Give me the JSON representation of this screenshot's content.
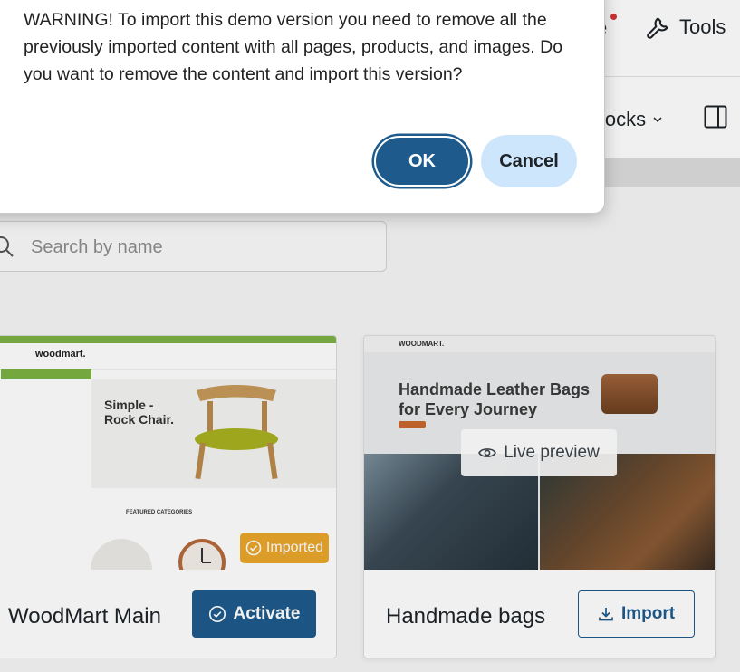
{
  "dialog": {
    "message": "WARNING! To import this demo version you need to remove all the previously imported content with all pages, products, and images. Do you want to remove the content and import this version?",
    "ok_label": "OK",
    "cancel_label": "Cancel"
  },
  "header": {
    "partial_text": "e",
    "tools_label": "Tools",
    "tools_icon": "wrench-icon",
    "notification_color": "#d63638"
  },
  "toolbar": {
    "blocks_partial_label": "locks",
    "panel_icon": "sidebar-panel-icon"
  },
  "search": {
    "placeholder": "Search by name"
  },
  "demos": [
    {
      "title": "WoodMart Main",
      "status_badge": "Imported",
      "action_label": "Activate",
      "thumbnail": {
        "logo": "woodmart.",
        "hero_line1": "Simple -",
        "hero_line2": "Rock Chair.",
        "section": "FEATURED CATEGORIES"
      }
    },
    {
      "title": "Handmade bags",
      "overlay_label": "Live preview",
      "action_label": "Import",
      "thumbnail": {
        "brand": "WOODMART.",
        "hero_line1": "Handmade Leather Bags",
        "hero_line2": "for Every Journey"
      }
    }
  ],
  "colors": {
    "primary": "#1e5b8c",
    "cancel_bg": "#cde6fb",
    "badge": "#e9a72a",
    "accent_green": "#7cb342"
  }
}
